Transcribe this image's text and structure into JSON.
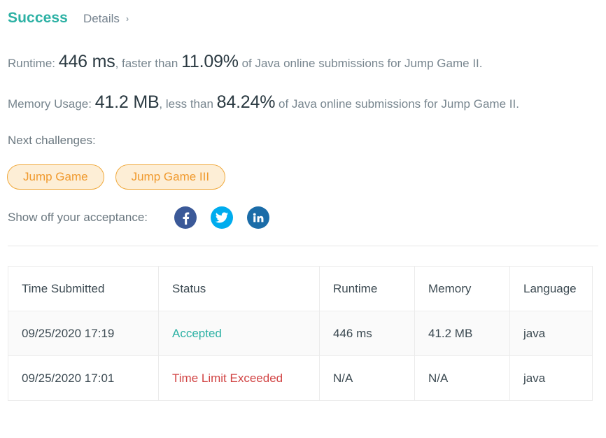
{
  "header": {
    "status_title": "Success",
    "details_label": "Details",
    "details_chevron": "›",
    "success_color": "#2cb1a4"
  },
  "stats": {
    "runtime": {
      "label": "Runtime:",
      "value": "446 ms",
      "comparator": ", faster than",
      "percentile": "11.09%",
      "suffix": "of Java online submissions for Jump Game II."
    },
    "memory": {
      "label": "Memory Usage:",
      "value": "41.2 MB",
      "comparator": ", less than",
      "percentile": "84.24%",
      "suffix": "of Java online submissions for Jump Game II."
    }
  },
  "next_challenges": {
    "label": "Next challenges:",
    "chips": [
      {
        "label": "Jump Game"
      },
      {
        "label": "Jump Game III"
      }
    ],
    "chip_border_color": "#f0a93c",
    "chip_fill_color": "#fdeed6",
    "chip_text_color": "#f09a2e"
  },
  "share": {
    "label": "Show off your acceptance:",
    "icons": [
      {
        "name": "facebook-icon",
        "color": "#3b5998"
      },
      {
        "name": "twitter-icon",
        "color": "#00acee"
      },
      {
        "name": "linkedin-icon",
        "color": "#1b6ca8"
      }
    ]
  },
  "submissions": {
    "columns": [
      "Time Submitted",
      "Status",
      "Runtime",
      "Memory",
      "Language"
    ],
    "rows": [
      {
        "time": "09/25/2020 17:19",
        "status": "Accepted",
        "status_kind": "accepted",
        "runtime": "446 ms",
        "memory": "41.2 MB",
        "language": "java"
      },
      {
        "time": "09/25/2020 17:01",
        "status": "Time Limit Exceeded",
        "status_kind": "tle",
        "runtime": "N/A",
        "memory": "N/A",
        "language": "java"
      }
    ],
    "accepted_color": "#2cb1a4",
    "error_color": "#d14343"
  }
}
